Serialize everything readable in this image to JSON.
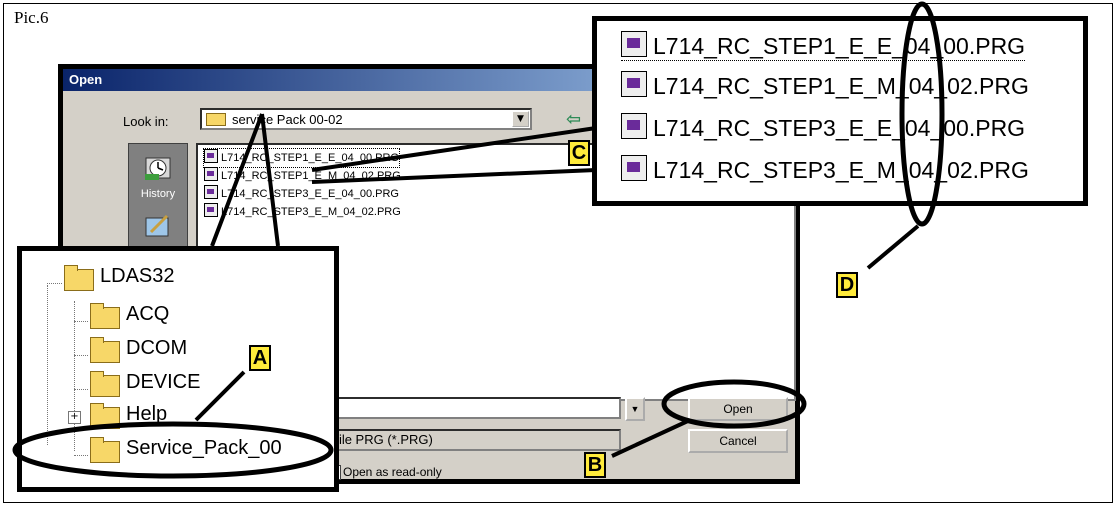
{
  "pic_label": "Pic.6",
  "dialog": {
    "title": "Open",
    "look_in_label": "Look in:",
    "look_in_value": "service Pack 00-02",
    "places": [
      {
        "label": "History",
        "icon": "history-icon"
      },
      {
        "label": "",
        "icon": "desktop-icon"
      }
    ],
    "files": [
      "L714_RC_STEP1_E_E_04_00.PRG",
      "L714_RC_STEP1_E_M_04_02.PRG",
      "L714_RC_STEP3_E_E_04_00.PRG",
      "L714_RC_STEP3_E_M_04_02.PRG"
    ],
    "file_name_value": "",
    "file_type_value": "File PRG (*.PRG)",
    "open_button": "Open",
    "cancel_button": "Cancel",
    "readonly_label": "Open as read-only"
  },
  "tree_callout": {
    "items": [
      "LDAS32",
      "ACQ",
      "DCOM",
      "DEVICE",
      "Help",
      "Service_Pack_00"
    ]
  },
  "zoom_callout": {
    "files": [
      "L714_RC_STEP1_E_E_04_00.PRG",
      "L714_RC_STEP1_E_M_04_02.PRG",
      "L714_RC_STEP3_E_E_04_00.PRG",
      "L714_RC_STEP3_E_M_04_02.PRG"
    ]
  },
  "markers": {
    "a": "A",
    "b": "B",
    "c": "C",
    "d": "D"
  },
  "colors": {
    "titlebar_start": "#0a246a",
    "titlebar_end": "#a6caf0",
    "folder": "#f7d768",
    "marker": "#ffeb3b"
  }
}
